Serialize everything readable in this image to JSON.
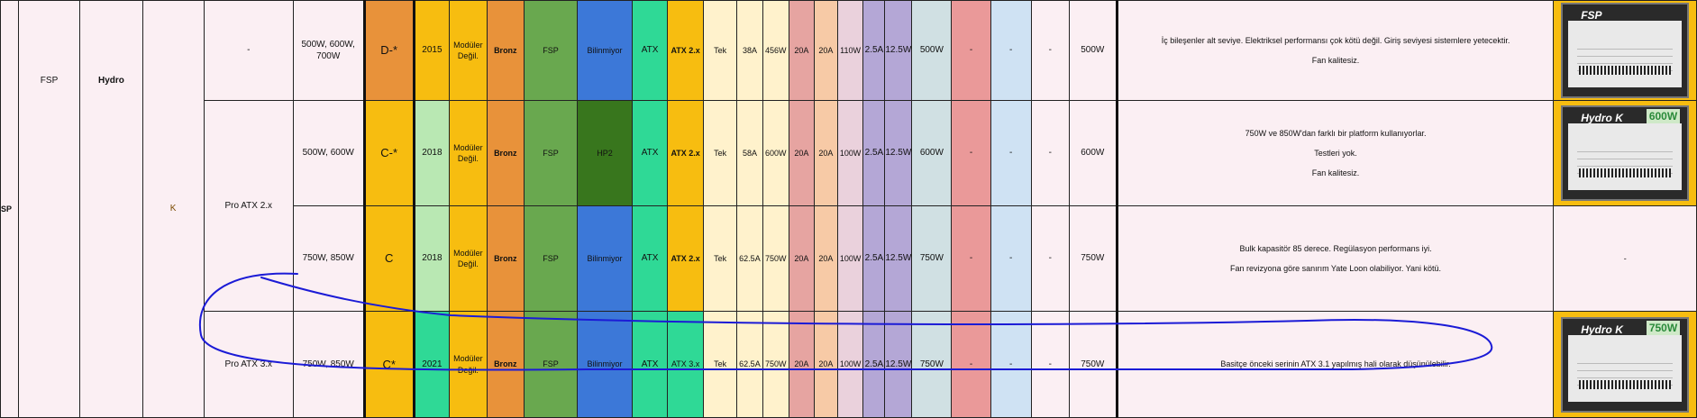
{
  "brand": {
    "logo_fragment": "SP",
    "oem": "FSP",
    "series": "Hydro",
    "tier": "K"
  },
  "models": [
    {
      "sub_series": "-",
      "wattages": "500W, 600W, 700W",
      "grade": "D-*",
      "year": "2015",
      "modularity": "Modüler Değil.",
      "efficiency": "Bronz",
      "manufacturer": "FSP",
      "platform": "Bilinmiyor",
      "form": "ATX",
      "atx_version": "ATX 2.x",
      "rail": "Tek",
      "amps_12v": "38A",
      "watts_12v": "456W",
      "amps_3v3": "20A",
      "amps_5v": "20A",
      "watts_minor": "110W",
      "amps_5vsb": "2.5A",
      "amps_neg12v": "12.5W",
      "continuous": "500W",
      "c1": "-",
      "c2": "-",
      "c3": "-",
      "tested": "500W",
      "notes": [
        "İç bileşenler alt seviye. Elektriksel performansı çok kötü değil. Giriş seviyesi sistemlere yetecektir.",
        "Fan kalitesiz."
      ],
      "photo": {
        "brand_text": "FSP",
        "watt_text": ""
      }
    },
    {
      "sub_series": "Pro ATX 2.x",
      "wattages": "500W, 600W",
      "grade": "C-*",
      "year": "2018",
      "modularity": "Modüler Değil.",
      "efficiency": "Bronz",
      "manufacturer": "FSP",
      "platform": "HP2",
      "form": "ATX",
      "atx_version": "ATX 2.x",
      "rail": "Tek",
      "amps_12v": "58A",
      "watts_12v": "600W",
      "amps_3v3": "20A",
      "amps_5v": "20A",
      "watts_minor": "100W",
      "amps_5vsb": "2.5A",
      "amps_neg12v": "12.5W",
      "continuous": "600W",
      "c1": "-",
      "c2": "-",
      "c3": "-",
      "tested": "600W",
      "notes": [
        "750W ve 850W'dan farklı bir platform kullanıyorlar.",
        "Testleri yok.",
        "Fan kalitesiz."
      ],
      "photo": {
        "brand_text": "Hydro K",
        "watt_text": "600W"
      }
    },
    {
      "sub_series": "",
      "wattages": "750W, 850W",
      "grade": "C",
      "year": "2018",
      "modularity": "Modüler Değil.",
      "efficiency": "Bronz",
      "manufacturer": "FSP",
      "platform": "Bilinmiyor",
      "form": "ATX",
      "atx_version": "ATX 2.x",
      "rail": "Tek",
      "amps_12v": "62.5A",
      "watts_12v": "750W",
      "amps_3v3": "20A",
      "amps_5v": "20A",
      "watts_minor": "100W",
      "amps_5vsb": "2.5A",
      "amps_neg12v": "12.5W",
      "continuous": "750W",
      "c1": "-",
      "c2": "-",
      "c3": "-",
      "tested": "750W",
      "notes": [
        "Bulk kapasitör 85 derece. Regülasyon performans iyi.",
        "Fan revizyona göre sanırım Yate Loon olabiliyor. Yani kötü."
      ],
      "photo_text": "-"
    },
    {
      "sub_series": "Pro ATX 3.x",
      "wattages": "750W, 850W",
      "grade": "C*",
      "year": "2021",
      "modularity": "Modüler Değil.",
      "efficiency": "Bronz",
      "manufacturer": "FSP",
      "platform": "Bilinmiyor",
      "form": "ATX",
      "atx_version": "ATX 3.x",
      "rail": "Tek",
      "amps_12v": "62.5A",
      "watts_12v": "750W",
      "amps_3v3": "20A",
      "amps_5v": "20A",
      "watts_minor": "100W",
      "amps_5vsb": "2.5A",
      "amps_neg12v": "12.5W",
      "continuous": "750W",
      "c1": "-",
      "c2": "-",
      "c3": "-",
      "tested": "750W",
      "notes": [
        "Basitçe önceki serinin ATX 3.1 yapılmış hali olarak düşünülebilir."
      ],
      "photo": {
        "brand_text": "Hydro K",
        "watt_text": "750W"
      }
    }
  ],
  "colors": {
    "row_bg": "#fbeff3",
    "grade_orange": "#e8923a",
    "grade_yellow": "#f7bd10",
    "year_green": "#b9e8b3",
    "year_teal": "#2fd996",
    "modular_yellow": "#f7bd10",
    "bronze": "#e8923a",
    "manufacturer_green": "#69a84f",
    "platform_blue": "#3c78d8",
    "platform_darkgreen": "#38761d",
    "form_teal": "#2fd996",
    "atx_yellow": "#f7bd10",
    "rail_cream": "#fff2cc",
    "amps_red": "#e6a4a1",
    "amps_peach": "#f7caa6",
    "minor_pink": "#ead1dc",
    "purple": "#b4a7d6",
    "slate": "#d0e0e3",
    "rose": "#ea9999",
    "lightblue": "#cfe2f3",
    "annotation": "#1b1bd6"
  },
  "annotation": {
    "shape": "hand-drawn-ellipse",
    "target_row": 4
  }
}
